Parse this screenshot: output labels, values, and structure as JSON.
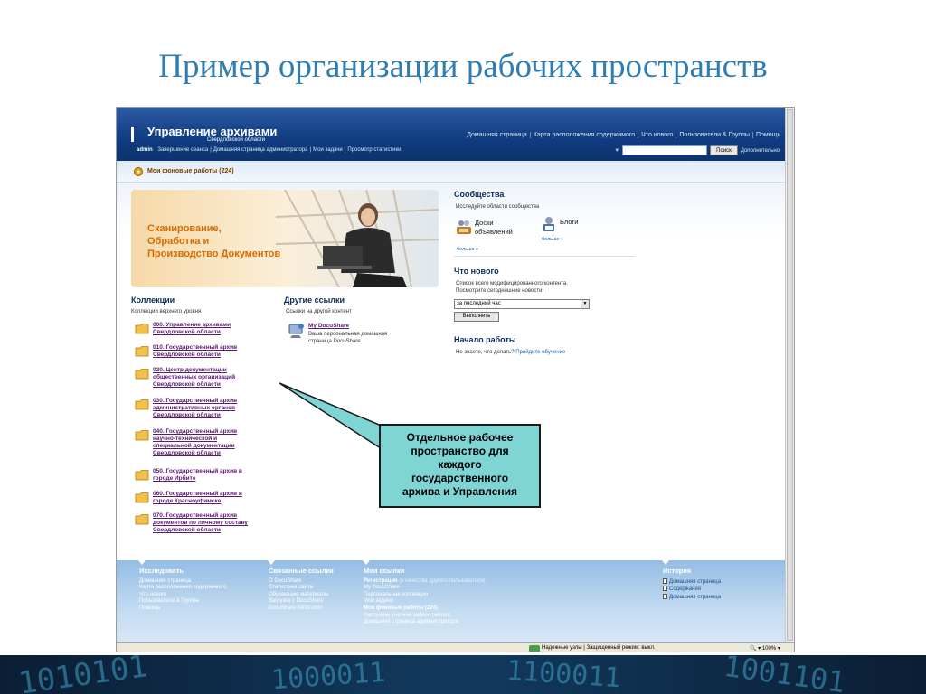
{
  "slide": {
    "title": "Пример организации рабочих пространств"
  },
  "header": {
    "brand_title": "Управление архивами",
    "brand_sub": "Свердловской области",
    "nav": [
      "Домашняя страница",
      "Карта расположения содержимого",
      "Что нового",
      "Пользователи & Группы",
      "Помощь"
    ],
    "user": "admin",
    "user_links": [
      "Завершение сеанса",
      "Домашняя страница администратора",
      "Мои задачи",
      "Просмотр статистики"
    ],
    "search_button": "Поиск",
    "advanced": "Дополнительно"
  },
  "bg_jobs": {
    "label": "Мои фоновые работы (224)"
  },
  "banner": {
    "text": [
      "Сканирование,",
      "Обработка и",
      "Производство Документов"
    ]
  },
  "collections": {
    "title": "Коллекции",
    "sub": "Коллекции верхнего уровня",
    "items": [
      [
        "000. Управление архивами",
        "Свердловской области"
      ],
      [
        "010. Государственный архив",
        "Свердловской области"
      ],
      [
        "020. Центр документации",
        "общественных организаций",
        "Свердловской области"
      ],
      [
        "030. Государственный архив",
        "административных органов",
        "Свердловской области"
      ],
      [
        "040. Государственный архив",
        "научно-технической и",
        "специальной документации",
        "Свердловской области"
      ],
      [
        "050. Государственный архив в",
        "городе Ирбите"
      ],
      [
        "060. Государственный архив в",
        "городе Красноуфимске"
      ],
      [
        "070. Государственный архив",
        "документов по личному составу",
        "Свердловской области"
      ]
    ]
  },
  "other_links": {
    "title": "Другие ссылки",
    "sub": "Ссылки на другой контент",
    "mydocushare": "My DocuShare",
    "mydocushare_desc": [
      "Ваша персональная домашняя",
      "страница DocuShare"
    ]
  },
  "communities": {
    "title": "Сообщества",
    "sub": "Исследуйте области сообщества",
    "boards": [
      "Доски",
      "объявлений"
    ],
    "blogs": "Блоги",
    "more": "больше »"
  },
  "whats_new": {
    "title": "Что нового",
    "desc": [
      "Список всего модифицированного контента.",
      "Посмотрите сегодняшние новости!"
    ],
    "select_value": "за последний час",
    "run": "Выполнить"
  },
  "getting_started": {
    "title": "Начало работы",
    "question": "Не знаете, что делать?",
    "link": "Пройдите обучение"
  },
  "callout": {
    "lines": [
      "Отдельное рабочее",
      "пространство для",
      "каждого",
      "государственного",
      "архива и Управления"
    ]
  },
  "footer": {
    "explore": {
      "title": "Исследовать",
      "items": [
        "Домашняя страница",
        "Карта расположения содержимого",
        "Что нового",
        "Пользователи & Группы",
        "Помощь"
      ]
    },
    "related": {
      "title": "Связанные ссылки",
      "items": [
        "О DocuShare",
        "Статистика сайта",
        "Обучающие материалы",
        "Загрузка с DocuShare",
        "DocuShare.xerox.com"
      ]
    },
    "mylinks": {
      "title": "Мои ссылки",
      "register": "Регистрация",
      "register_hint": "(в качестве другого пользователя)",
      "items": [
        "My DocuShare",
        "Персональная коллекция",
        "Мои задачи"
      ],
      "bg_jobs": "Мои фоновые работы (224)",
      "items2": [
        "Настройки учетной записи (admin)",
        "Домашняя страница администратора"
      ]
    },
    "history": {
      "title": "История",
      "items": [
        "Домашняя страница",
        "Содержания",
        "Домашняя страница"
      ]
    }
  },
  "status": {
    "zone": "Надежные узлы | Защищенный режим: выкл.",
    "zoom": "100%"
  },
  "decor": {
    "binary_1": "1010101",
    "binary_2": "1000011",
    "binary_3": "1100011",
    "binary_4": "1001101"
  }
}
